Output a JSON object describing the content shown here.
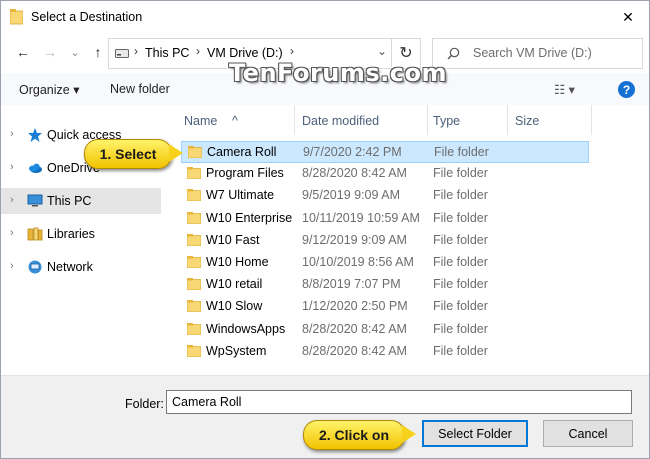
{
  "window": {
    "title": "Select a Destination",
    "close_glyph": "✕"
  },
  "nav_buttons": {
    "back": "←",
    "forward": "→",
    "recent": "⌄",
    "up": "↑"
  },
  "address": {
    "crumbs": [
      "This PC",
      "VM Drive (D:)"
    ],
    "separator": "›",
    "dropdown": "⌄",
    "refresh_glyph": "↻"
  },
  "search": {
    "placeholder": "Search VM Drive (D:)"
  },
  "watermark": "TenForums.com",
  "toolbar": {
    "organize": "Organize ▾",
    "new_folder": "New folder",
    "view_glyph": "☷ ▾",
    "help": "?"
  },
  "nav_pane": [
    {
      "label": "Quick access",
      "icon": "star-icon"
    },
    {
      "label": "OneDrive",
      "icon": "cloud-icon"
    },
    {
      "label": "This PC",
      "icon": "computer-icon",
      "selected": true
    },
    {
      "label": "Libraries",
      "icon": "libraries-icon"
    },
    {
      "label": "Network",
      "icon": "network-icon"
    }
  ],
  "columns": {
    "name": "Name",
    "date": "Date modified",
    "type": "Type",
    "size": "Size",
    "sort_glyph": "^"
  },
  "files": [
    {
      "name": "Camera Roll",
      "date": "9/7/2020 2:42 PM",
      "type": "File folder",
      "selected": true
    },
    {
      "name": "Program Files",
      "date": "8/28/2020 8:42 AM",
      "type": "File folder"
    },
    {
      "name": "W7 Ultimate",
      "date": "9/5/2019 9:09 AM",
      "type": "File folder"
    },
    {
      "name": "W10 Enterprise",
      "date": "10/11/2019 10:59 AM",
      "type": "File folder"
    },
    {
      "name": "W10 Fast",
      "date": "9/12/2019 9:09 AM",
      "type": "File folder"
    },
    {
      "name": "W10 Home",
      "date": "10/10/2019 8:56 AM",
      "type": "File folder"
    },
    {
      "name": "W10 retail",
      "date": "8/8/2019 7:07 PM",
      "type": "File folder"
    },
    {
      "name": "W10 Slow",
      "date": "1/12/2020 2:50 PM",
      "type": "File folder"
    },
    {
      "name": "WindowsApps",
      "date": "8/28/2020 8:42 AM",
      "type": "File folder"
    },
    {
      "name": "WpSystem",
      "date": "8/28/2020 8:42 AM",
      "type": "File folder"
    }
  ],
  "footer": {
    "folder_label": "Folder:",
    "folder_value": "Camera Roll",
    "select_button": "Select Folder",
    "cancel_button": "Cancel"
  },
  "callouts": {
    "step1": "1. Select",
    "step2": "2. Click on"
  },
  "colors": {
    "accent": "#0078d7",
    "selection": "#cce8ff",
    "folder": "#f8d775",
    "callout": "#f6d21c"
  }
}
